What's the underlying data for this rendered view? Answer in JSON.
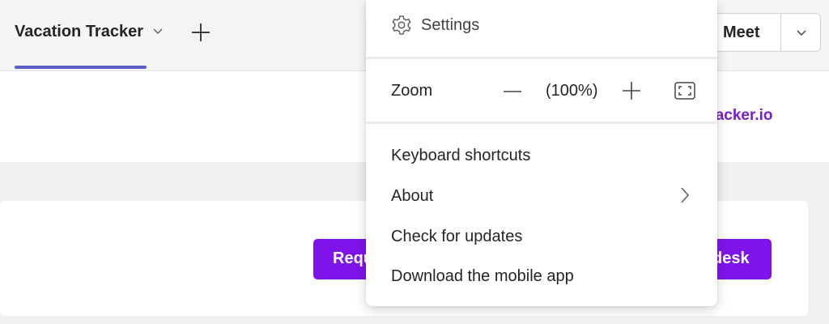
{
  "tab": {
    "title": "Vacation Tracker"
  },
  "header": {
    "meet_label": "Meet"
  },
  "banner": {
    "link_text": "tracker.io"
  },
  "card": {
    "request_button": "Requ",
    "desk_button": "desk"
  },
  "menu": {
    "settings_label": "Settings",
    "zoom_label": "Zoom",
    "zoom_value": "(100%)",
    "items": [
      {
        "label": "Keyboard shortcuts"
      },
      {
        "label": "About"
      },
      {
        "label": "Check for updates"
      },
      {
        "label": "Download the mobile app"
      }
    ]
  },
  "colors": {
    "accent": "#5b5fc7",
    "brand_purple": "#7f14ea",
    "link_purple": "#7a1bd6"
  },
  "icons": [
    "chevron-down-icon",
    "plus-icon",
    "gear-icon",
    "minus-icon",
    "fit-screen-icon",
    "chevron-right-icon"
  ]
}
